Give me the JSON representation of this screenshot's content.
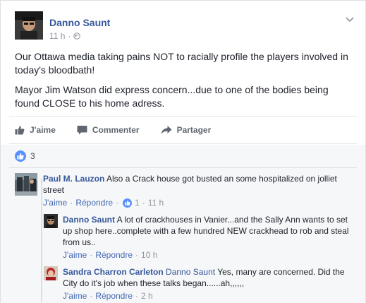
{
  "post": {
    "author": "Danno Saunt",
    "time": "11 h",
    "paragraphs": [
      "Our Ottawa media taking pains NOT to racially profile the players involved in today's bloodbath!",
      "Mayor Jim Watson did express concern...due to one of the bodies being found CLOSE to his home adress."
    ]
  },
  "actions": {
    "like": "J'aime",
    "comment": "Commenter",
    "share": "Partager"
  },
  "reactions": {
    "count": "3"
  },
  "comments": [
    {
      "author": "Paul M. Lauzon",
      "text": "Also a Crack house got busted an some hospitalized on jolliet street",
      "like_label": "J'aime",
      "reply_label": "Répondre",
      "likes": "1",
      "time": "11 h",
      "separator": "·"
    },
    {
      "author": "Danno Saunt",
      "text": "A lot of crackhouses in Vanier...and the Sally Ann wants to set up shop here..complete with a few hundred NEW crackhead to rob and steal from us..",
      "like_label": "J'aime",
      "reply_label": "Répondre",
      "time": "10 h",
      "separator": "·"
    },
    {
      "author": "Sandra Charron Carleton",
      "mention": "Danno Saunt",
      "text": "Yes, many are concerned. Did the City do it's job when these talks began......ah,,,,,,",
      "like_label": "J'aime",
      "reply_label": "Répondre",
      "time": "2 h",
      "separator": "·"
    }
  ],
  "colors": {
    "link_blue": "#365899",
    "action_blue": "#4267b2",
    "like_blue": "#5890ff",
    "meta_grey": "#90949c",
    "comment_bg": "#f6f7f9"
  },
  "icons": {
    "globe": "globe-icon",
    "chevron": "chevron-down-icon",
    "like": "thumbs-up-icon",
    "comment": "speech-bubble-icon",
    "share": "share-arrow-icon"
  }
}
